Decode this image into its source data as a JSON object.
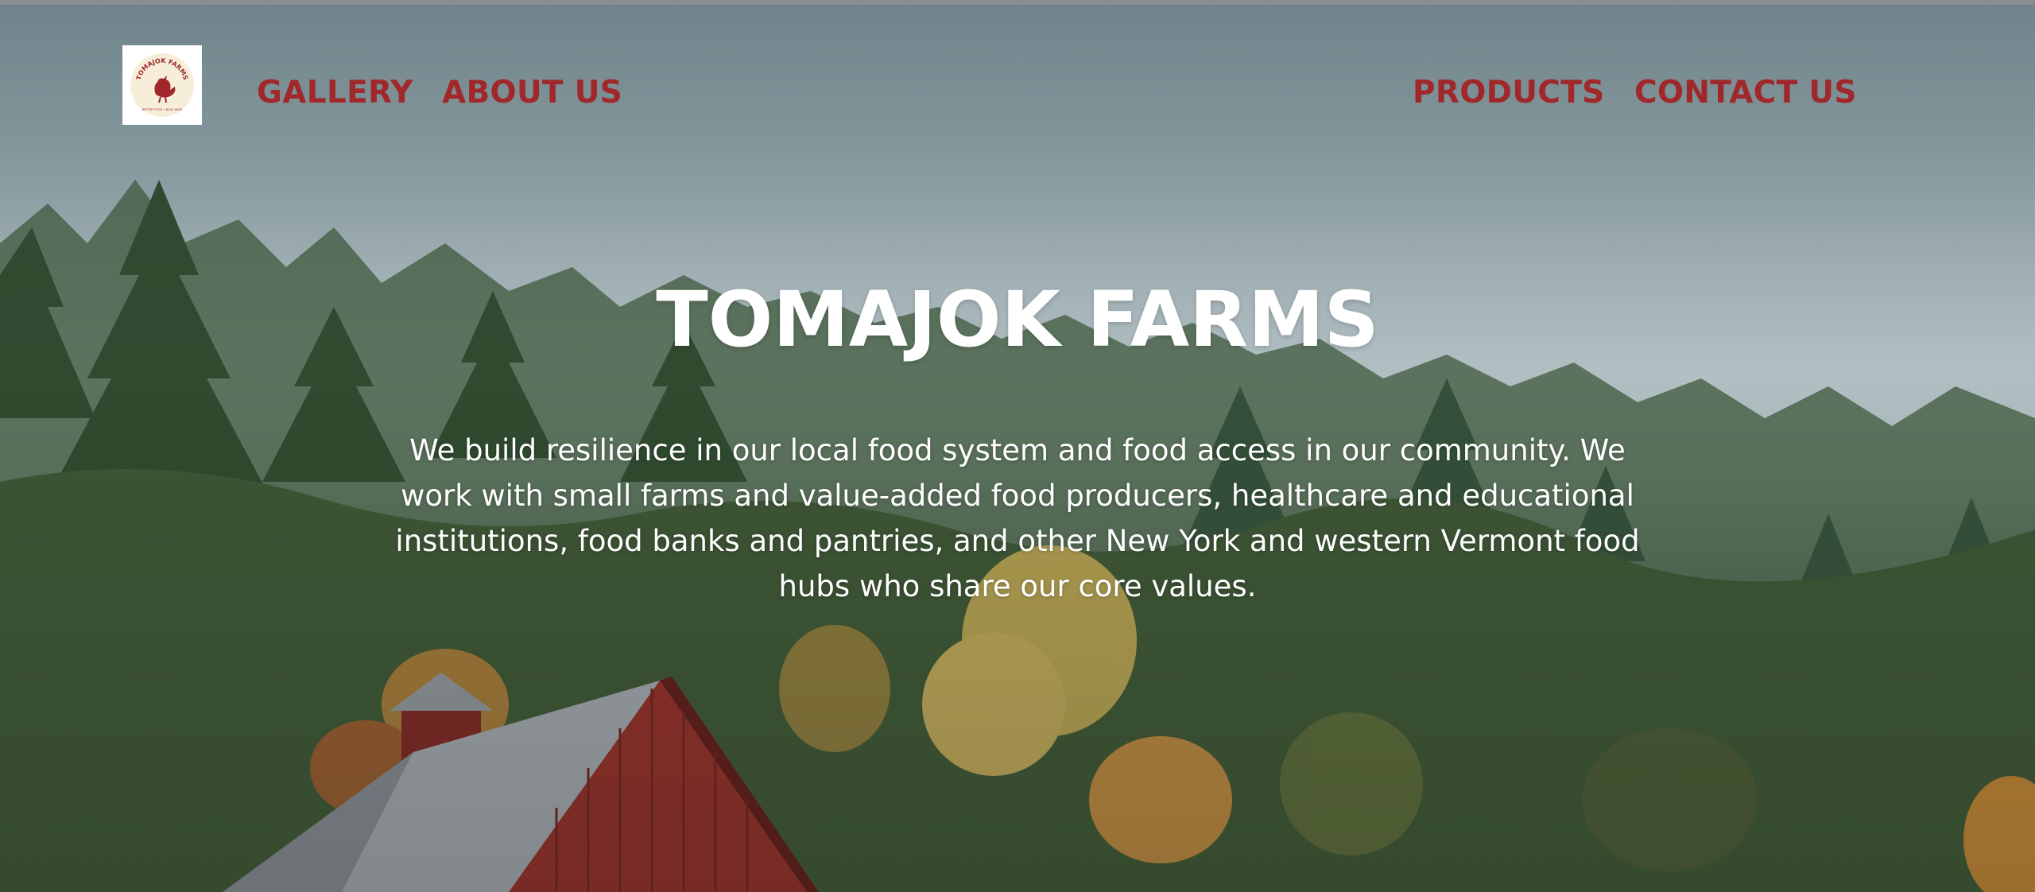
{
  "site": {
    "logo": {
      "badge_text": "TOMAJOK FARMS",
      "tagline": "BETTER FOOD • BUILT WIDE"
    },
    "nav": {
      "gallery": "GALLERY",
      "about": "ABOUT US",
      "products": "PRODUCTS",
      "contact": "CONTACT US"
    }
  },
  "hero": {
    "title": "TOMAJOK FARMS",
    "description": "We build resilience in our local food system and food access in our community. We work with small farms and value-added food producers, healthcare and educational institutions, food banks and pantries, and other New York and western Vermont food hubs who share our core values."
  },
  "colors": {
    "nav_accent": "#a0282a",
    "hero_text": "#ffffff",
    "barn_red": "#8e2f2a"
  },
  "icons": {
    "logo": "rooster-logo-icon"
  }
}
